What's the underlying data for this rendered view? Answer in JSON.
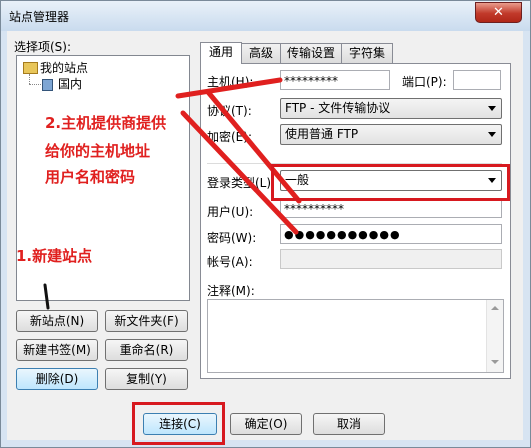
{
  "window": {
    "title": "站点管理器",
    "close_label": "✕"
  },
  "left": {
    "select_label": "选择项(S):",
    "tree": [
      {
        "label": "我的站点",
        "icon": "folder-icon"
      },
      {
        "label": "国内",
        "icon": "computer-icon"
      }
    ],
    "buttons": {
      "new_site": "新站点(N)",
      "new_folder": "新文件夹(F)",
      "new_bookmark": "新建书签(M)",
      "rename": "重命名(R)",
      "delete": "删除(D)",
      "copy": "复制(Y)"
    }
  },
  "tabs": [
    "通用",
    "高级",
    "传输设置",
    "字符集"
  ],
  "general": {
    "host_label": "主机(H):",
    "host_value": "*********",
    "port_label": "端口(P):",
    "port_value": "",
    "protocol_label": "协议(T):",
    "protocol_value": "FTP - 文件传输协议",
    "encryption_label": "加密(E):",
    "encryption_value": "使用普通 FTP",
    "logon_label": "登录类型(L):",
    "logon_value": "一般",
    "user_label": "用户(U):",
    "user_value": "**********",
    "password_label": "密码(W):",
    "password_value": "●●●●●●●●●●●",
    "account_label": "帐号(A):",
    "account_value": "",
    "comments_label": "注释(M):"
  },
  "footer": {
    "connect": "连接(C)",
    "ok": "确定(O)",
    "cancel": "取消"
  },
  "annotations": {
    "step1": "1.新建站点",
    "step2_line1": "2.主机提供商提供",
    "step2_line2": "给你的主机地址",
    "step2_line3": "用户名和密码"
  },
  "colors": {
    "annotation": "#e0201f"
  }
}
